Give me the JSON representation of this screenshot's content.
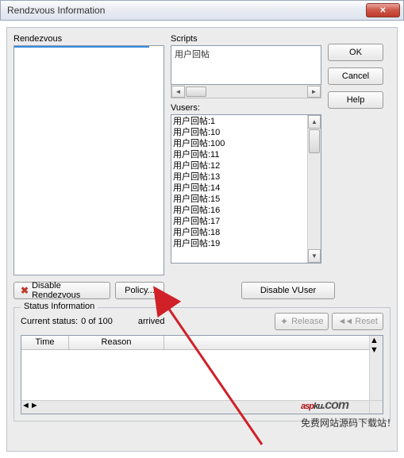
{
  "window": {
    "title": "Rendzvous Information"
  },
  "labels": {
    "rendezvous": "Rendezvous",
    "scripts": "Scripts",
    "vusers": "Vusers:",
    "status_legend": "Status Information",
    "current_status": "Current status:",
    "arrived": "arrived"
  },
  "rendezvous": {
    "selected": " "
  },
  "scripts": {
    "content": "用户回帖"
  },
  "vusers": {
    "items": [
      "用户回帖:1",
      "用户回帖:10",
      "用户回帖:100",
      "用户回帖:11",
      "用户回帖:12",
      "用户回帖:13",
      "用户回帖:14",
      "用户回帖:15",
      "用户回帖:16",
      "用户回帖:17",
      "用户回帖:18",
      "用户回帖:19"
    ]
  },
  "buttons": {
    "ok": "OK",
    "cancel": "Cancel",
    "help": "Help",
    "disable_rendezvous": "Disable Rendezvous",
    "policy": "Policy...",
    "disable_vuser": "Disable VUser",
    "release": "Release",
    "reset": "Reset"
  },
  "status": {
    "value": "0 of 100"
  },
  "grid": {
    "col_time": "Time",
    "col_reason": "Reason"
  },
  "watermark": {
    "brand_l": "asp",
    "brand_r": "ku",
    "dot": ".com",
    "tagline": "免费网站源码下载站！"
  }
}
